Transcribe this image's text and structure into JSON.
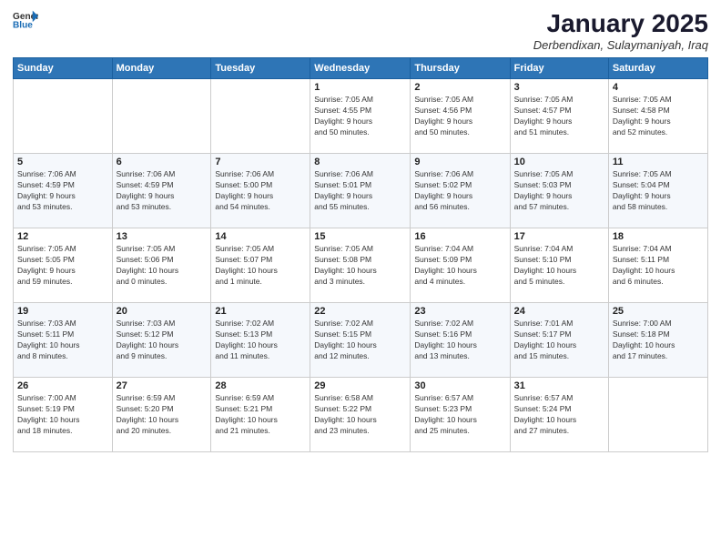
{
  "header": {
    "logo_general": "General",
    "logo_blue": "Blue",
    "title": "January 2025",
    "subtitle": "Derbendixan, Sulaymaniyah, Iraq"
  },
  "days_of_week": [
    "Sunday",
    "Monday",
    "Tuesday",
    "Wednesday",
    "Thursday",
    "Friday",
    "Saturday"
  ],
  "weeks": [
    [
      {
        "day": "",
        "info": ""
      },
      {
        "day": "",
        "info": ""
      },
      {
        "day": "",
        "info": ""
      },
      {
        "day": "1",
        "info": "Sunrise: 7:05 AM\nSunset: 4:55 PM\nDaylight: 9 hours\nand 50 minutes."
      },
      {
        "day": "2",
        "info": "Sunrise: 7:05 AM\nSunset: 4:56 PM\nDaylight: 9 hours\nand 50 minutes."
      },
      {
        "day": "3",
        "info": "Sunrise: 7:05 AM\nSunset: 4:57 PM\nDaylight: 9 hours\nand 51 minutes."
      },
      {
        "day": "4",
        "info": "Sunrise: 7:05 AM\nSunset: 4:58 PM\nDaylight: 9 hours\nand 52 minutes."
      }
    ],
    [
      {
        "day": "5",
        "info": "Sunrise: 7:06 AM\nSunset: 4:59 PM\nDaylight: 9 hours\nand 53 minutes."
      },
      {
        "day": "6",
        "info": "Sunrise: 7:06 AM\nSunset: 4:59 PM\nDaylight: 9 hours\nand 53 minutes."
      },
      {
        "day": "7",
        "info": "Sunrise: 7:06 AM\nSunset: 5:00 PM\nDaylight: 9 hours\nand 54 minutes."
      },
      {
        "day": "8",
        "info": "Sunrise: 7:06 AM\nSunset: 5:01 PM\nDaylight: 9 hours\nand 55 minutes."
      },
      {
        "day": "9",
        "info": "Sunrise: 7:06 AM\nSunset: 5:02 PM\nDaylight: 9 hours\nand 56 minutes."
      },
      {
        "day": "10",
        "info": "Sunrise: 7:05 AM\nSunset: 5:03 PM\nDaylight: 9 hours\nand 57 minutes."
      },
      {
        "day": "11",
        "info": "Sunrise: 7:05 AM\nSunset: 5:04 PM\nDaylight: 9 hours\nand 58 minutes."
      }
    ],
    [
      {
        "day": "12",
        "info": "Sunrise: 7:05 AM\nSunset: 5:05 PM\nDaylight: 9 hours\nand 59 minutes."
      },
      {
        "day": "13",
        "info": "Sunrise: 7:05 AM\nSunset: 5:06 PM\nDaylight: 10 hours\nand 0 minutes."
      },
      {
        "day": "14",
        "info": "Sunrise: 7:05 AM\nSunset: 5:07 PM\nDaylight: 10 hours\nand 1 minute."
      },
      {
        "day": "15",
        "info": "Sunrise: 7:05 AM\nSunset: 5:08 PM\nDaylight: 10 hours\nand 3 minutes."
      },
      {
        "day": "16",
        "info": "Sunrise: 7:04 AM\nSunset: 5:09 PM\nDaylight: 10 hours\nand 4 minutes."
      },
      {
        "day": "17",
        "info": "Sunrise: 7:04 AM\nSunset: 5:10 PM\nDaylight: 10 hours\nand 5 minutes."
      },
      {
        "day": "18",
        "info": "Sunrise: 7:04 AM\nSunset: 5:11 PM\nDaylight: 10 hours\nand 6 minutes."
      }
    ],
    [
      {
        "day": "19",
        "info": "Sunrise: 7:03 AM\nSunset: 5:11 PM\nDaylight: 10 hours\nand 8 minutes."
      },
      {
        "day": "20",
        "info": "Sunrise: 7:03 AM\nSunset: 5:12 PM\nDaylight: 10 hours\nand 9 minutes."
      },
      {
        "day": "21",
        "info": "Sunrise: 7:02 AM\nSunset: 5:13 PM\nDaylight: 10 hours\nand 11 minutes."
      },
      {
        "day": "22",
        "info": "Sunrise: 7:02 AM\nSunset: 5:15 PM\nDaylight: 10 hours\nand 12 minutes."
      },
      {
        "day": "23",
        "info": "Sunrise: 7:02 AM\nSunset: 5:16 PM\nDaylight: 10 hours\nand 13 minutes."
      },
      {
        "day": "24",
        "info": "Sunrise: 7:01 AM\nSunset: 5:17 PM\nDaylight: 10 hours\nand 15 minutes."
      },
      {
        "day": "25",
        "info": "Sunrise: 7:00 AM\nSunset: 5:18 PM\nDaylight: 10 hours\nand 17 minutes."
      }
    ],
    [
      {
        "day": "26",
        "info": "Sunrise: 7:00 AM\nSunset: 5:19 PM\nDaylight: 10 hours\nand 18 minutes."
      },
      {
        "day": "27",
        "info": "Sunrise: 6:59 AM\nSunset: 5:20 PM\nDaylight: 10 hours\nand 20 minutes."
      },
      {
        "day": "28",
        "info": "Sunrise: 6:59 AM\nSunset: 5:21 PM\nDaylight: 10 hours\nand 21 minutes."
      },
      {
        "day": "29",
        "info": "Sunrise: 6:58 AM\nSunset: 5:22 PM\nDaylight: 10 hours\nand 23 minutes."
      },
      {
        "day": "30",
        "info": "Sunrise: 6:57 AM\nSunset: 5:23 PM\nDaylight: 10 hours\nand 25 minutes."
      },
      {
        "day": "31",
        "info": "Sunrise: 6:57 AM\nSunset: 5:24 PM\nDaylight: 10 hours\nand 27 minutes."
      },
      {
        "day": "",
        "info": ""
      }
    ]
  ]
}
